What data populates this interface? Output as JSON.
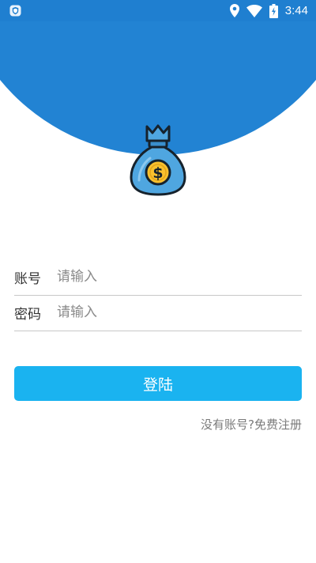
{
  "status_bar": {
    "time": "3:44",
    "icons": [
      "shield-icon",
      "location-icon",
      "wifi-icon",
      "battery-charging-icon"
    ]
  },
  "header": {
    "logo_icon": "money-bag-icon",
    "colors": {
      "arc": "#2283d3",
      "bag": "#4fa6e0",
      "coin": "#f9c02e"
    }
  },
  "form": {
    "account": {
      "label": "账号",
      "placeholder": "请输入",
      "value": ""
    },
    "password": {
      "label": "密码",
      "placeholder": "请输入",
      "value": ""
    },
    "login_label": "登陆",
    "register_link": "没有账号?免费注册"
  },
  "colors": {
    "primary_button": "#1ab3f0",
    "divider": "#c8c8c8"
  }
}
